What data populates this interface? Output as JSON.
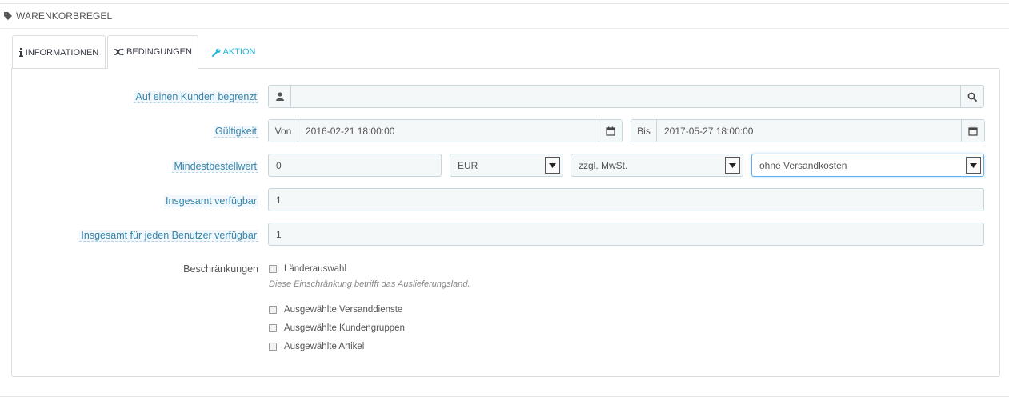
{
  "header": {
    "title": "WARENKORBREGEL",
    "icon": "tag-icon"
  },
  "tabs": [
    {
      "label": "INFORMATIONEN",
      "icon": "info-icon",
      "active": false
    },
    {
      "label": "BEDINGUNGEN",
      "icon": "shuffle-icon",
      "active": true
    },
    {
      "label": "AKTION",
      "icon": "wrench-icon",
      "active": false
    }
  ],
  "form": {
    "customer": {
      "label": "Auf einen Kunden begrenzt",
      "value": ""
    },
    "validity": {
      "label": "Gültigkeit",
      "from_label": "Von",
      "from_value": "2016-02-21 18:00:00",
      "to_label": "Bis",
      "to_value": "2017-05-27 18:00:00"
    },
    "minimum": {
      "label": "Mindestbestellwert",
      "amount": "0",
      "currency": "EUR",
      "tax": "zzgl. MwSt.",
      "shipping": "ohne Versandkosten"
    },
    "total_available": {
      "label": "Insgesamt verfügbar",
      "value": "1"
    },
    "per_user": {
      "label": "Insgesamt für jeden Benutzer verfügbar",
      "value": "1"
    },
    "restrictions": {
      "label": "Beschränkungen",
      "country": "Länderauswahl",
      "help": "Diese Einschränkung betrifft das Auslieferungsland.",
      "carriers": "Ausgewählte Versanddienste",
      "groups": "Ausgewählte Kundengruppen",
      "products": "Ausgewählte Artikel"
    }
  },
  "colors": {
    "accent": "#25b9d7",
    "tip_label": "#3586ae",
    "input_bg": "#f5f8f9",
    "input_border": "#c7d6db"
  }
}
